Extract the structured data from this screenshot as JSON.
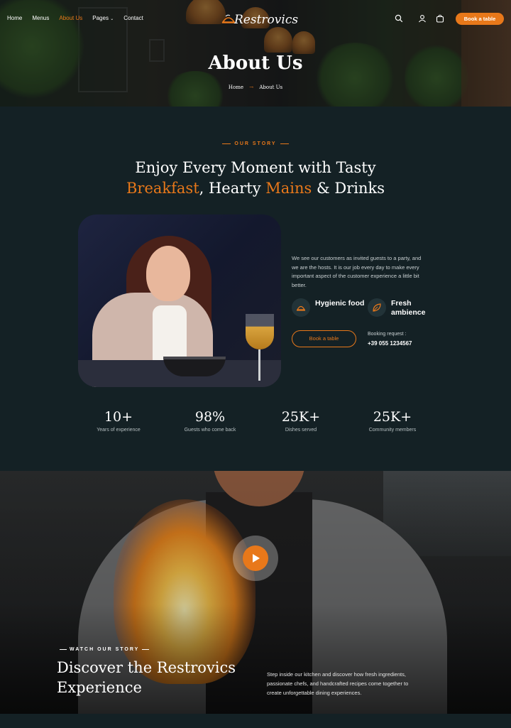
{
  "nav": {
    "links": [
      "Home",
      "Menus",
      "About Us",
      "Pages",
      "Contact"
    ],
    "pages_chevron": "⌄",
    "logo": "Restrovics",
    "book_button": "Book a table"
  },
  "hero": {
    "title": "About Us",
    "breadcrumb_home": "Home",
    "breadcrumb_arrow": "→",
    "breadcrumb_current": "About Us"
  },
  "story": {
    "eyebrow": "OUR STORY",
    "heading_line1": "Enjoy Every Moment with Tasty",
    "heading_hl1": "Breakfast",
    "heading_mid": ", Hearty ",
    "heading_hl2": "Mains",
    "heading_end": " & Drinks",
    "intro": "We see our customers as invited guests to a party, and we are the hosts. It is our job every day to make every important aspect of the customer experience a little bit better.",
    "features": [
      {
        "label": "Hygienic food",
        "icon": "cloche-icon"
      },
      {
        "label": "Fresh ambience",
        "icon": "leaf-icon"
      }
    ],
    "book_button": "Book a table",
    "booking_label": "Booking request :",
    "booking_phone": "+39 055 1234567",
    "stats": [
      {
        "value": "10+",
        "caption": "Years of experience"
      },
      {
        "value": "98%",
        "caption": "Guests who come back"
      },
      {
        "value": "25K+",
        "caption": "Dishes served"
      },
      {
        "value": "25K+",
        "caption": "Community members"
      }
    ]
  },
  "video": {
    "eyebrow": "WATCH OUR STORY",
    "title": "Discover the Restrovics Experience",
    "text": "Step inside our kitchen and discover how fresh ingredients, passionate chefs, and handcrafted recipes come together to create unforgettable dining experiences."
  },
  "colors": {
    "accent": "#e8781a",
    "background": "#142125"
  }
}
